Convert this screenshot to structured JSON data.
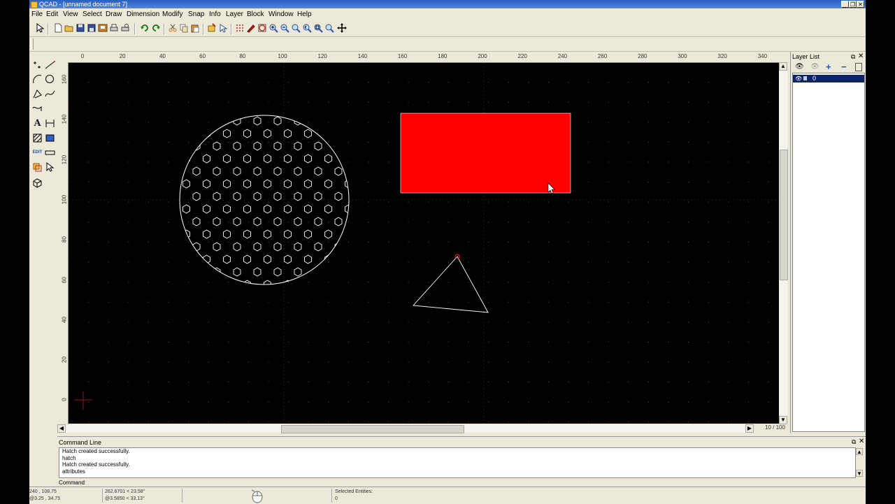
{
  "window": {
    "title": "QCAD - [unnamed document 7]",
    "buttons": [
      "_",
      "❐",
      "✕"
    ]
  },
  "menu": [
    "File",
    "Edit",
    "View",
    "Select",
    "Draw",
    "Dimension",
    "Modify",
    "Snap",
    "Info",
    "Layer",
    "Block",
    "Window",
    "Help"
  ],
  "ruler": {
    "x_ticks": [
      "0",
      "20",
      "40",
      "60",
      "80",
      "100",
      "120",
      "140",
      "160",
      "180",
      "200",
      "220",
      "240",
      "260",
      "280",
      "300",
      "320",
      "340"
    ],
    "y_ticks": [
      "160",
      "140",
      "120",
      "100",
      "80",
      "60",
      "40",
      "20",
      "0"
    ]
  },
  "canvas": {
    "background": "#000000",
    "rectangle_color": "#ff0000",
    "outline_color": "#ffffff",
    "shapes": [
      "hatched-circle",
      "filled-rectangle",
      "triangle"
    ]
  },
  "zoom_label": "10 / 100",
  "layer_panel": {
    "title": "Layer List",
    "layers": [
      {
        "name": "0"
      }
    ]
  },
  "command_panel": {
    "title": "Command Line",
    "history": [
      "Hatch created successfully.",
      "hatch",
      "Hatch created successfully.",
      "attributes"
    ],
    "prompt": "Command:"
  },
  "status": {
    "abs_coord": "240 , 108.75",
    "abs_coord2": "@3.25 , 34.75",
    "polar": "262.6701 < 23.58°",
    "polar2": "@3.5850 < 33.13°",
    "selected_label": "Selected Entities:",
    "selected_count": "0"
  }
}
